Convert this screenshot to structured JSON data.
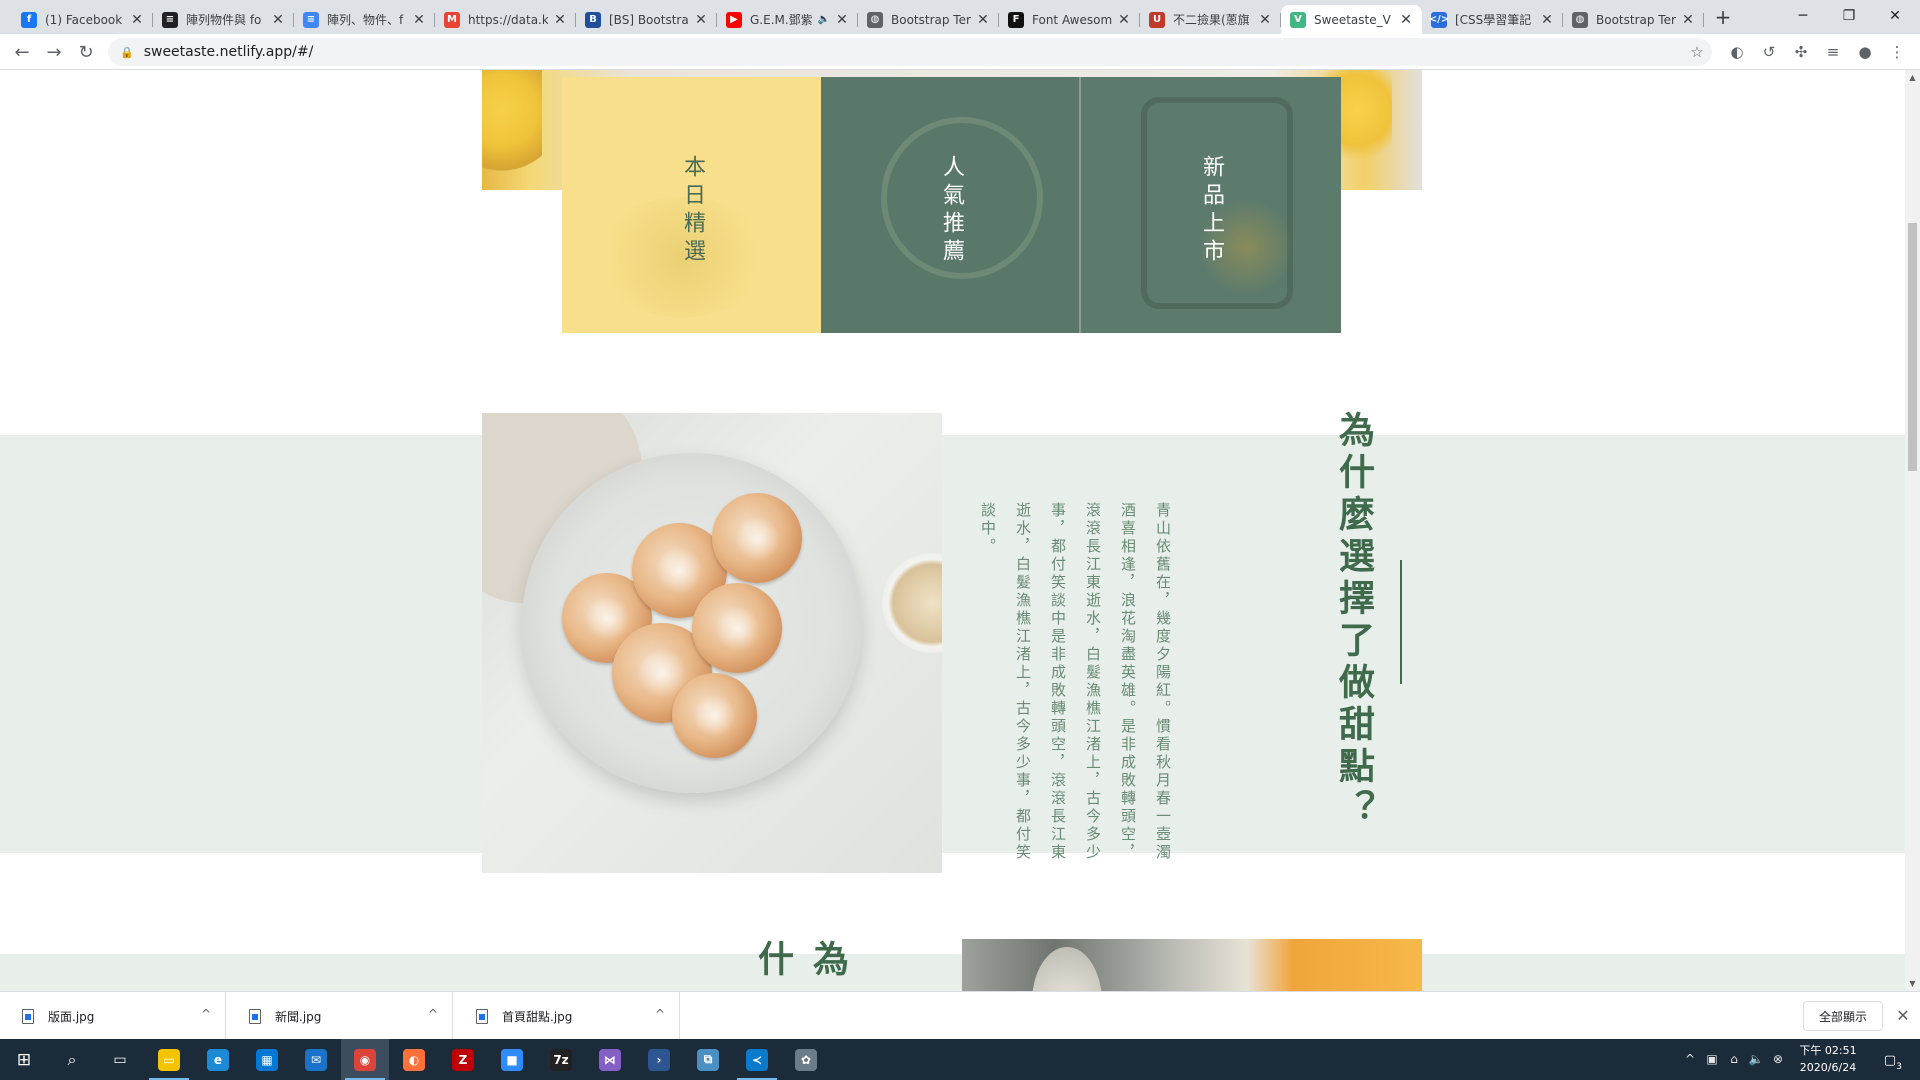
{
  "browser": {
    "tabs": [
      {
        "title": "(1) Facebook",
        "icon": "facebook-icon",
        "color": "#1877f2",
        "glyph": "f"
      },
      {
        "title": "陣列物件與 fo",
        "icon": "document-icon",
        "color": "#202124",
        "glyph": "≡"
      },
      {
        "title": "陣列、物件、f",
        "icon": "docs-icon",
        "color": "#4285f4",
        "glyph": "≡"
      },
      {
        "title": "https://data.k",
        "icon": "gmail-icon",
        "color": "#ea4335",
        "glyph": "M"
      },
      {
        "title": "[BS] Bootstrap",
        "icon": "bs-icon",
        "color": "#1f4e9b",
        "glyph": "B"
      },
      {
        "title": "G.E.M.鄧紫",
        "icon": "youtube-icon",
        "color": "#ff0000",
        "glyph": "▶",
        "audio": "🔈"
      },
      {
        "title": "Bootstrap Ter",
        "icon": "globe-icon",
        "color": "#5f6368",
        "glyph": "◍"
      },
      {
        "title": "Font Awesom",
        "icon": "fontawesome-icon",
        "color": "#111111",
        "glyph": "F"
      },
      {
        "title": "不二撿果(蔥旗",
        "icon": "bookmark-icon",
        "color": "#c0392b",
        "glyph": "U"
      },
      {
        "title": "Sweetaste_V",
        "icon": "vue-icon",
        "color": "#41b883",
        "glyph": "V",
        "active": true
      },
      {
        "title": "[CSS學習筆記",
        "icon": "code-icon",
        "color": "#2a6fdb",
        "glyph": "</>"
      },
      {
        "title": "Bootstrap Ter",
        "icon": "globe-icon",
        "color": "#5f6368",
        "glyph": "◍"
      }
    ],
    "address": "sweetaste.netlify.app/#/"
  },
  "page": {
    "categories": [
      {
        "label": "本日精選"
      },
      {
        "label": "人氣推薦"
      },
      {
        "label": "新品上市"
      }
    ],
    "why_section": {
      "title": "為什麼選擇了做甜點？",
      "body": "青山依舊在，幾度夕陽紅。慣看秋月春一壺濁酒喜相逢，浪花淘盡英雄。是非成敗轉頭空，滾滾長江東逝水，白髮漁樵江渚上，古今多少事，都付笑談中是非成敗轉頭空，滾滾長江東逝水，白髮漁樵江渚上，古今多少事，都付笑談中。"
    },
    "next_section": {
      "title": "為什"
    }
  },
  "downloads": {
    "items": [
      {
        "name": "版面.jpg"
      },
      {
        "name": "新聞.jpg"
      },
      {
        "name": "首頁甜點.jpg"
      }
    ],
    "show_all": "全部顯示"
  },
  "taskbar": {
    "apps": [
      {
        "icon": "file-explorer-icon",
        "color": "#f5c400",
        "glyph": "▭",
        "running": true
      },
      {
        "icon": "edge-icon",
        "color": "#1e8ad6",
        "glyph": "e"
      },
      {
        "icon": "store-icon",
        "color": "#0078d4",
        "glyph": "▦"
      },
      {
        "icon": "mail-icon",
        "color": "#1a73c8",
        "glyph": "✉"
      },
      {
        "icon": "chrome-icon",
        "color": "#db4437",
        "glyph": "◉",
        "running": true,
        "active": true
      },
      {
        "icon": "firefox-icon",
        "color": "#ff7139",
        "glyph": "◐"
      },
      {
        "icon": "filezilla-icon",
        "color": "#bf0000",
        "glyph": "Z"
      },
      {
        "icon": "zoom-icon",
        "color": "#2d8cff",
        "glyph": "■"
      },
      {
        "icon": "7zip-icon",
        "color": "#222222",
        "glyph": "7z"
      },
      {
        "icon": "visual-studio-icon",
        "color": "#865fc5",
        "glyph": "⋈"
      },
      {
        "icon": "powershell-icon",
        "color": "#2c5591",
        "glyph": "›"
      },
      {
        "icon": "network-tool-icon",
        "color": "#4a90c2",
        "glyph": "⧉"
      },
      {
        "icon": "vscode-icon",
        "color": "#0a7acc",
        "glyph": "≺",
        "running": true
      },
      {
        "icon": "settings-app-icon",
        "color": "#6b7b8a",
        "glyph": "✿"
      }
    ],
    "time": "下午 02:51",
    "date": "2020/6/24",
    "notifications": "3"
  }
}
